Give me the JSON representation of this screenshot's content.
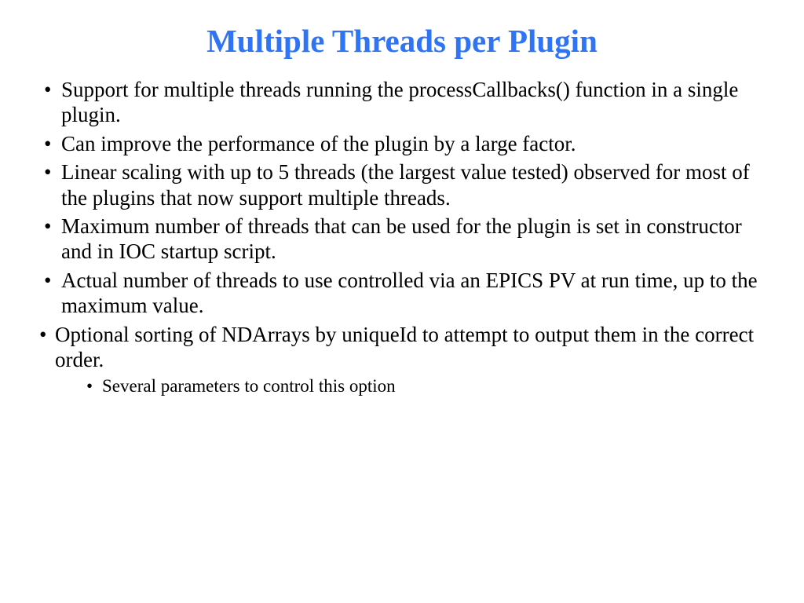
{
  "slide": {
    "title": "Multiple Threads per Plugin",
    "bullets": [
      "Support for multiple threads running the processCallbacks() function in a single plugin.",
      "Can improve the performance of the plugin by a large factor.",
      "Linear scaling with up to 5 threads (the largest value tested) observed for most of the plugins that now support multiple threads.",
      "Maximum number of threads that can be used for the plugin is set in constructor and in IOC startup script.",
      "Actual number of threads to use controlled via an EPICS PV at run time, up to the maximum value.",
      "Optional sorting of NDArrays by uniqueId to attempt to output them in the correct order."
    ],
    "subbullet": "Several parameters to control this option"
  }
}
